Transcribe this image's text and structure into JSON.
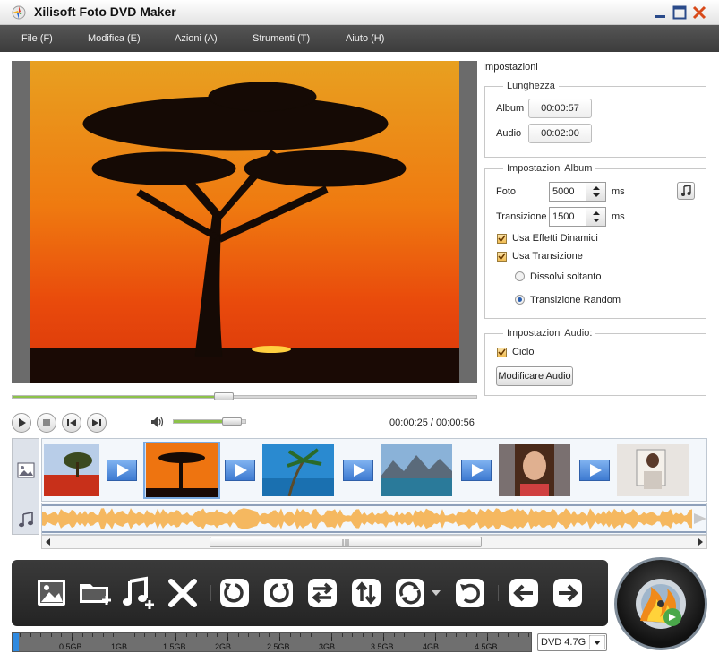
{
  "window": {
    "title": "Xilisoft Foto DVD Maker"
  },
  "menu": [
    "File (F)",
    "Modifica (E)",
    "Azioni (A)",
    "Strumenti (T)",
    "Aiuto (H)"
  ],
  "player": {
    "progress_fraction": 0.455,
    "volume_fraction": 0.8,
    "time": "00:00:25 / 00:00:56"
  },
  "settings": {
    "title": "Impostazioni",
    "length": {
      "legend": "Lunghezza",
      "album_label": "Album",
      "album_value": "00:00:57",
      "audio_label": "Audio",
      "audio_value": "00:02:00"
    },
    "album": {
      "legend": "Impostazioni Album",
      "photo_label": "Foto",
      "photo_value": "5000",
      "photo_unit": "ms",
      "transition_label": "Transizione",
      "transition_value": "1500",
      "transition_unit": "ms",
      "dynamic_effects_label": "Usa Effetti Dinamici",
      "dynamic_effects_checked": true,
      "use_transition_label": "Usa Transizione",
      "use_transition_checked": true,
      "dissolve_label": "Dissolvi soltanto",
      "random_label": "Transizione Random",
      "selected_transition": "random"
    },
    "audio": {
      "legend": "Impostazioni Audio:",
      "loop_label": "Ciclo",
      "loop_checked": true,
      "edit_button": "Modificare Audio"
    }
  },
  "capacity": {
    "ticks": [
      "0.5GB",
      "1GB",
      "1.5GB",
      "2GB",
      "2.5GB",
      "3GB",
      "3.5GB",
      "4GB",
      "4.5GB"
    ],
    "disc_type": "DVD 4.7G"
  },
  "colors": {
    "accent_green": "#8dc24a",
    "selection_blue": "#7aa9e0",
    "transition_blue": "#3d7ad1",
    "toolbar_dark": "#2c2c2c"
  },
  "icons": {
    "toolbar": [
      "add-photo-icon",
      "add-folder-icon",
      "add-music-icon",
      "delete-icon",
      "rotate-left-icon",
      "rotate-right-icon",
      "swap-icon",
      "sort-icon",
      "transition-icon",
      "undo-icon",
      "move-left-icon",
      "move-right-icon"
    ]
  }
}
